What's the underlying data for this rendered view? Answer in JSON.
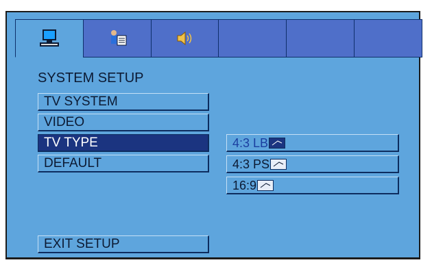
{
  "tabs": [
    {
      "name": "system-tab",
      "icon": "monitor-icon"
    },
    {
      "name": "language-tab",
      "icon": "person-book-icon"
    },
    {
      "name": "audio-tab",
      "icon": "speaker-icon"
    },
    {
      "name": "empty-tab-4",
      "icon": ""
    },
    {
      "name": "empty-tab-5",
      "icon": ""
    },
    {
      "name": "empty-tab-6",
      "icon": ""
    }
  ],
  "menu": {
    "title": "SYSTEM SETUP",
    "items": [
      "TV SYSTEM",
      "VIDEO",
      "TV TYPE",
      "DEFAULT"
    ],
    "selected": "TV TYPE",
    "exit": "EXIT SETUP"
  },
  "options": {
    "items": [
      "4:3 LB",
      "4:3 PS",
      "16:9"
    ],
    "current": "4:3 LB"
  },
  "colors": {
    "panel": "#5ea5dd",
    "tab": "#4f6fc9",
    "selected": "#1b3480",
    "text": "#0c1a33"
  }
}
